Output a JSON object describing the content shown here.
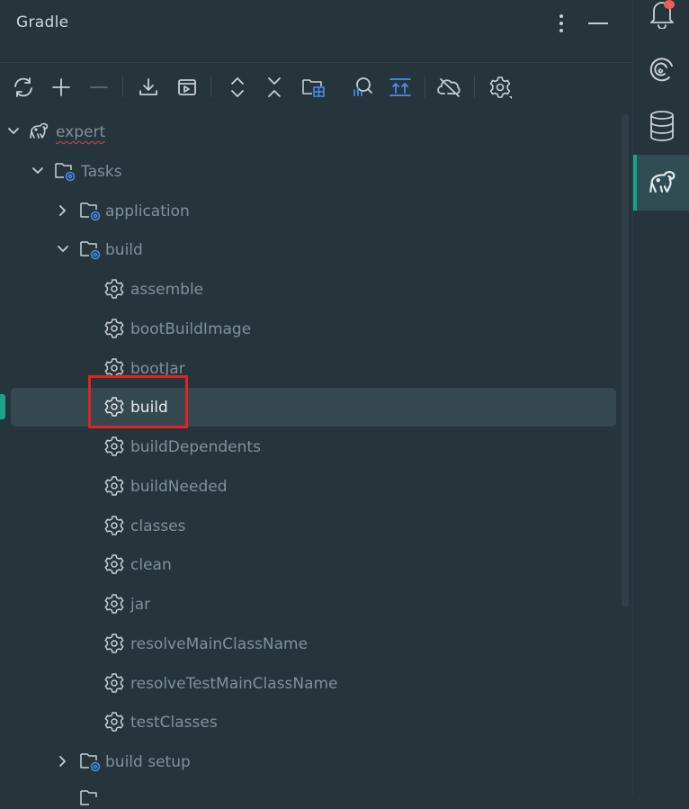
{
  "header": {
    "title": "Gradle",
    "more_icon": "more-vertical-icon",
    "minimize_icon": "minimize-icon"
  },
  "toolbar": {
    "buttons": [
      {
        "name": "reload-all-button",
        "icon": "reload-icon"
      },
      {
        "name": "add-button",
        "icon": "plus-icon"
      },
      {
        "name": "remove-button",
        "icon": "minus-icon"
      },
      {
        "name": "download-sources-button",
        "icon": "download-icon"
      },
      {
        "name": "execute-task-button",
        "icon": "run-terminal-icon"
      },
      {
        "name": "expand-all-button",
        "icon": "expand-all-icon"
      },
      {
        "name": "collapse-all-button",
        "icon": "collapse-all-icon"
      },
      {
        "name": "group-modules-button",
        "icon": "folder-grid-icon"
      },
      {
        "name": "analyze-dependencies-button",
        "icon": "analyze-icon"
      },
      {
        "name": "show-upstream-button",
        "icon": "upload-arrows-icon"
      },
      {
        "name": "offline-mode-button",
        "icon": "cloud-off-icon"
      },
      {
        "name": "settings-button",
        "icon": "gear-icon"
      }
    ]
  },
  "tree": {
    "root": {
      "label": "expert"
    },
    "tasks_folder": {
      "label": "Tasks"
    },
    "folders": {
      "application": "application",
      "build": "build",
      "build_setup": "build setup"
    },
    "build_tasks": [
      "assemble",
      "bootBuildImage",
      "bootJar",
      "build",
      "buildDependents",
      "buildNeeded",
      "classes",
      "clean",
      "jar",
      "resolveMainClassName",
      "resolveTestMainClassName",
      "testClasses"
    ],
    "selected_task": "build"
  },
  "right_strip": {
    "items": [
      {
        "name": "notifications",
        "icon": "bell-icon",
        "badge": true
      },
      {
        "name": "ai-assistant",
        "icon": "spiral-icon"
      },
      {
        "name": "database",
        "icon": "database-icon"
      },
      {
        "name": "gradle",
        "icon": "gradle-elephant-icon",
        "active": true
      }
    ]
  },
  "colors": {
    "background": "#26343c",
    "selection": "#35474f",
    "accent": "#1aa38a",
    "highlight_box": "#e02424",
    "badge": "#e8615b",
    "folder_gear": "#4a8cf0"
  }
}
